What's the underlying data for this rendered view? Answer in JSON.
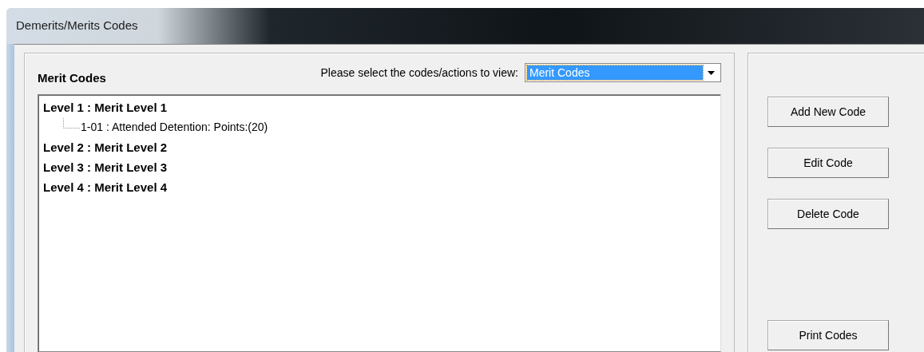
{
  "window": {
    "title": "Demerits/Merits Codes"
  },
  "panel": {
    "heading": "Merit Codes"
  },
  "selector": {
    "label": "Please select the codes/actions to view:",
    "value": "Merit Codes"
  },
  "tree": {
    "nodes": [
      {
        "label": "Level 1 : Merit Level 1",
        "children": [
          {
            "label": "1-01 : Attended Detention: Points:(20)"
          }
        ]
      },
      {
        "label": "Level 2 : Merit Level 2"
      },
      {
        "label": "Level 3 : Merit Level 3"
      },
      {
        "label": "Level 4 : Merit Level 4"
      }
    ]
  },
  "actions": {
    "top": [
      "Add New Code",
      "Edit Code",
      "Delete Code"
    ],
    "bottom": [
      "Print Codes"
    ]
  }
}
